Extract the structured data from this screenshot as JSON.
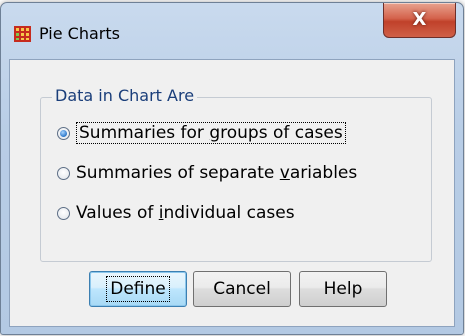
{
  "window": {
    "title": "Pie Charts",
    "close_label": "X"
  },
  "group": {
    "label": "Data in Chart Are",
    "options": [
      {
        "pre": "Summaries for ",
        "mnemonic": "g",
        "post": "roups of cases",
        "selected": true
      },
      {
        "pre": "Summaries of separate ",
        "mnemonic": "v",
        "post": "ariables",
        "selected": false
      },
      {
        "pre": "Values of ",
        "mnemonic": "i",
        "post": "ndividual cases",
        "selected": false
      }
    ]
  },
  "buttons": {
    "define": "Define",
    "cancel": "Cancel",
    "help": "Help"
  },
  "colors": {
    "title_frame": "#b8cde6",
    "close_button": "#c94a33",
    "group_label": "#1a3e7a",
    "default_button": "#bee6fd"
  }
}
